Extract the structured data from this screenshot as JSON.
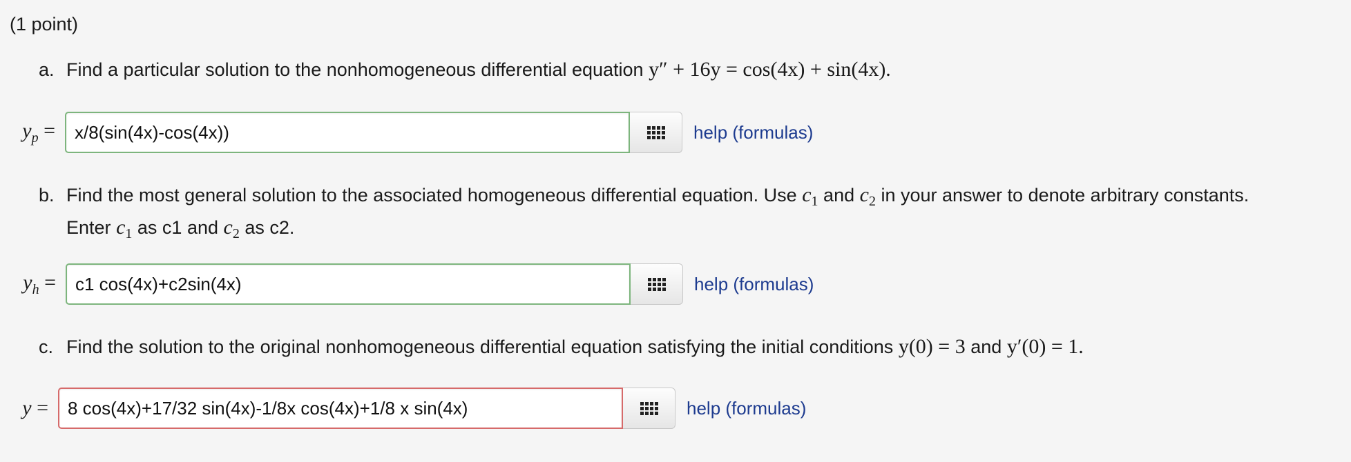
{
  "points": "(1 point)",
  "parts": {
    "a": {
      "letter": "a.",
      "prompt_before": "Find a particular solution to the nonhomogeneous differential equation",
      "equation": "y″ + 16y = cos(4x) + sin(4x).",
      "lhs": "y",
      "lhs_sub": "p",
      "lhs_eq": "=",
      "answer": "x/8(sin(4x)-cos(4x))",
      "status": "correct"
    },
    "b": {
      "letter": "b.",
      "prompt_line1_a": "Find the most general solution to the associated homogeneous differential equation. Use",
      "c1": "c",
      "c1_sub": "1",
      "and": "and",
      "c2": "c",
      "c2_sub": "2",
      "prompt_line1_b": "in your answer to denote arbitrary constants.",
      "enter": "Enter",
      "as_c1": "as c1 and",
      "as_c2": "as c2.",
      "lhs": "y",
      "lhs_sub": "h",
      "lhs_eq": "=",
      "answer": "c1 cos(4x)+c2sin(4x)",
      "status": "correct"
    },
    "c": {
      "letter": "c.",
      "prompt_before": "Find the solution to the original nonhomogeneous differential equation satisfying the initial conditions",
      "cond1": "y(0) = 3",
      "and": "and",
      "cond2": "y′(0) = 1.",
      "lhs": "y",
      "lhs_eq": "=",
      "answer": "8 cos(4x)+17/32 sin(4x)-1/8x cos(4x)+1/8 x sin(4x)",
      "status": "incorrect"
    }
  },
  "help_label": "help (formulas)",
  "palette_icon": "grid-icon",
  "colors": {
    "correct_border": "#7db57d",
    "incorrect_border": "#d66a6a",
    "link": "#1d3b8f"
  }
}
